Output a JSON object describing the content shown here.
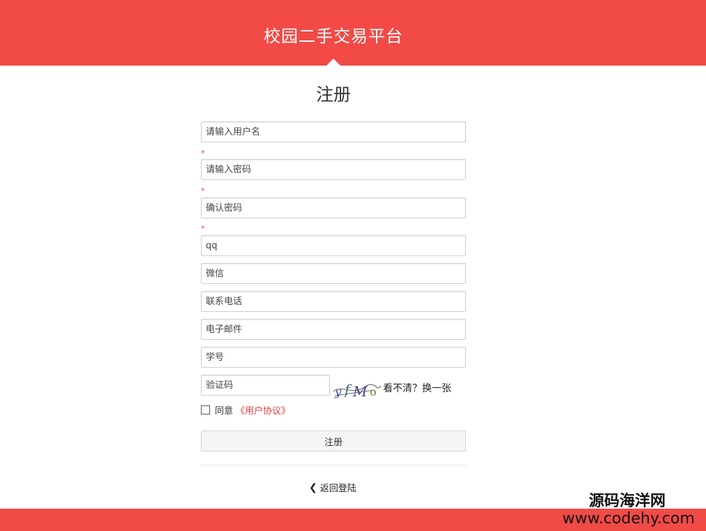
{
  "header": {
    "title": "校园二手交易平台"
  },
  "page": {
    "title": "注册"
  },
  "form": {
    "required_mark": "*",
    "username": {
      "placeholder": "请输入用户名",
      "value": ""
    },
    "password": {
      "placeholder": "请输入密码",
      "value": ""
    },
    "confirm_password": {
      "placeholder": "确认密码",
      "value": ""
    },
    "qq": {
      "placeholder": "qq",
      "value": ""
    },
    "wechat": {
      "placeholder": "微信",
      "value": ""
    },
    "phone": {
      "placeholder": "联系电话",
      "value": ""
    },
    "email": {
      "placeholder": "电子邮件",
      "value": ""
    },
    "student_id": {
      "placeholder": "学号",
      "value": ""
    },
    "captcha": {
      "placeholder": "验证码",
      "value": "",
      "image_text": "yfMo",
      "refresh_label": "看不清？换一张"
    },
    "agreement": {
      "checked": false,
      "label": "同意",
      "link_label": "《用户协议》"
    },
    "submit_label": "注册"
  },
  "back_link": {
    "label": "返回登陆",
    "icon": "chevron-left-icon"
  },
  "watermark": {
    "line1": "源码海洋网",
    "line2": "www.codehy.com"
  },
  "colors": {
    "brand": "#f24a46",
    "required": "#e23c3c"
  }
}
